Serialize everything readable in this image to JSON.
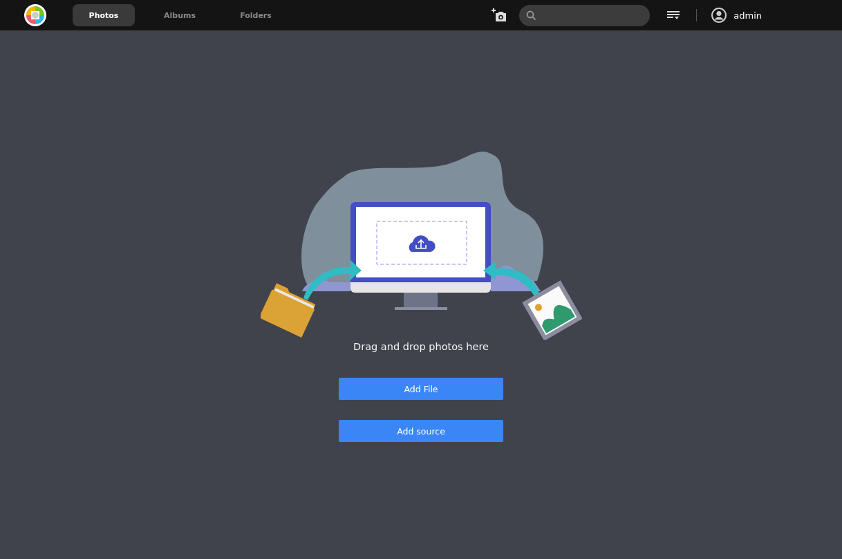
{
  "nav_tabs": [
    {
      "label": "Photos",
      "selected": true
    },
    {
      "label": "Albums",
      "selected": false
    },
    {
      "label": "Folders",
      "selected": false
    }
  ],
  "user": {
    "name": "admin"
  },
  "dropzone": {
    "message": "Drag and drop photos here",
    "buttons": [
      "Add File",
      "Add source"
    ]
  }
}
